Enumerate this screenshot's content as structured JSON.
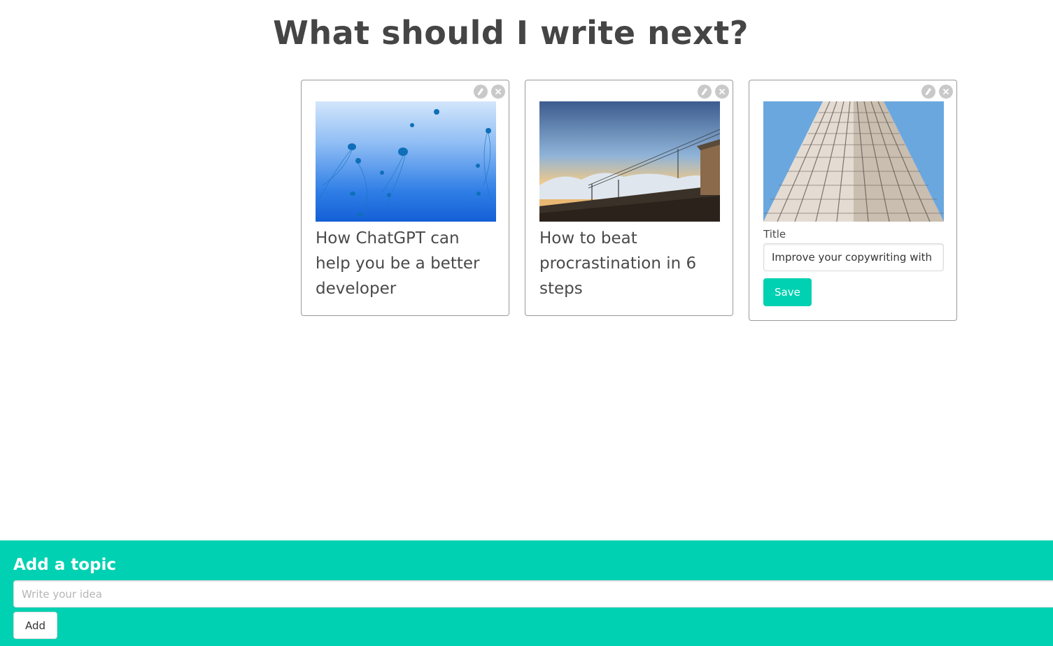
{
  "page": {
    "title": "What should I write next?"
  },
  "cards": [
    {
      "image": "jellyfish-photo",
      "title": "How ChatGPT can help you be a better developer",
      "actions": {
        "edit_icon": "pencil-icon",
        "delete_icon": "close-icon"
      }
    },
    {
      "image": "mountain-sunset-chairlift-photo",
      "title": "How to beat procrastination in 6 steps",
      "actions": {
        "edit_icon": "pencil-icon",
        "delete_icon": "close-icon"
      }
    },
    {
      "image": "skyscraper-photo",
      "editing": true,
      "field_label": "Title",
      "input_value": "Improve your copywriting with the",
      "save_label": "Save",
      "actions": {
        "edit_icon": "pencil-icon",
        "delete_icon": "close-icon"
      }
    }
  ],
  "footer": {
    "heading": "Add a topic",
    "input_placeholder": "Write your idea",
    "add_label": "Add"
  },
  "colors": {
    "accent": "#00d1b2",
    "text": "#4a4a4a",
    "card_border": "#9a9a9a",
    "icon_bg": "#c9c9c9"
  }
}
